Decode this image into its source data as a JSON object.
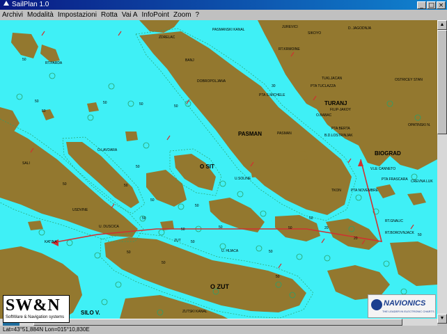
{
  "window": {
    "title": "SailPlan 1.0"
  },
  "menu": [
    "Archivi",
    "Modalità",
    "Impostazioni",
    "Rotta",
    "Vai A",
    "InfoPoint",
    "Zoom",
    "?"
  ],
  "map": {
    "place_labels": [
      "PASMANSKI KANAL",
      "ZDRELAC",
      "JUREVICI",
      "SIKOYO",
      "D. JAGODNJA",
      "RT.KRMOINE",
      "RT.PARDA",
      "BANJ",
      "DOBROPOLJANA",
      "TUKLJACAN",
      "PTA TUCLAZZA",
      "OSTRICEY STAN",
      "PTA S.MICHELE",
      "TURANJ",
      "FILIP-JAKOY",
      "OPATINSKI N.",
      "O.BABAC",
      "PTA BERTA",
      "B.D.LOSTRINJAK",
      "PASMAN",
      "BIOGRAD",
      "O.LAVDARA",
      "O SIT",
      "SALI",
      "V.LE CANNETO",
      "PTA FRASCARA",
      "CREVNA LUK",
      "TKON",
      "PTA NOVEMBRE",
      "U.SOLINE",
      "USDVINE",
      "U. DUSCICA",
      "RT.GNALIC",
      "RT.BOROVNJACK",
      "KATINA",
      "ZUT",
      "U. HIJACA",
      "O ZUT",
      "SILO V.",
      "ZUTSKI KANAL",
      "PASMAN"
    ],
    "depth_labels": [
      "50",
      "50",
      "50",
      "50",
      "50",
      "50",
      "50",
      "50",
      "50",
      "50",
      "50",
      "50",
      "50",
      "50",
      "50",
      "50",
      "50",
      "50",
      "50",
      "30",
      "20",
      "20",
      "50",
      "50",
      "50"
    ]
  },
  "logos": {
    "swn": "SW&N",
    "swn_sub": "SoftWare & Navigation systems",
    "navionics": "NAVIONICS",
    "navionics_sub": "THE LEADER IN ELECTRONIC CHARTS"
  },
  "scale": "4 NM",
  "status": {
    "coords": "Lat=43°51,884N Lon=015°10,830E"
  },
  "colors": {
    "land": "#93782f",
    "sea": "#3ff0f6",
    "route": "#d03030",
    "title_bar": "#0a1a84"
  }
}
